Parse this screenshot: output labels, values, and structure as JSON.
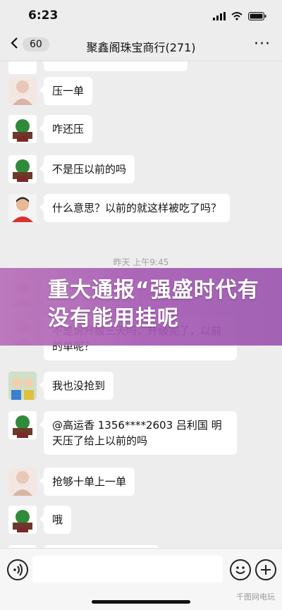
{
  "status": {
    "time": "6:23"
  },
  "nav": {
    "back_count": "60",
    "title": "聚鑫阁珠宝商行(271)",
    "more": "···"
  },
  "messages": [
    {
      "text": "压一单"
    },
    {
      "text": "咋还压"
    },
    {
      "text": "不是压以前的吗"
    },
    {
      "text": "什么意思？以前的就这样被吃了吗？"
    },
    {
      "text": "不是说升级三天吗，升级完了，以前的单呢？"
    },
    {
      "text": "我也没抢到"
    },
    {
      "text": "@高运香 1356****2603 吕利国 明天压了给上以前的吗"
    },
    {
      "text": "抢够十单上一单"
    },
    {
      "text": "哦"
    }
  ],
  "time_separator": "昨天 上午9:45",
  "banner": {
    "text": "重大通报“强盛时代有没有能用挂呢"
  },
  "watermark": "千图网电玩"
}
